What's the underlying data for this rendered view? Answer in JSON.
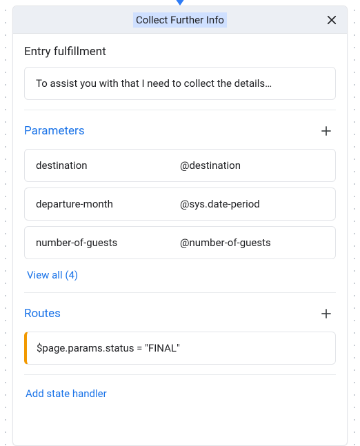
{
  "header": {
    "title": "Collect Further Info"
  },
  "entry_fulfillment": {
    "heading": "Entry fulfillment",
    "message": "To assist you with that I need to collect the details…"
  },
  "parameters": {
    "heading": "Parameters",
    "items": [
      {
        "name": "destination",
        "type": "@destination"
      },
      {
        "name": "departure-month",
        "type": "@sys.date-period"
      },
      {
        "name": "number-of-guests",
        "type": "@number-of-guests"
      }
    ],
    "view_all_label": "View all (4)"
  },
  "routes": {
    "heading": "Routes",
    "items": [
      {
        "condition": "$page.params.status = \"FINAL\""
      }
    ]
  },
  "add_state_handler_label": "Add state handler"
}
